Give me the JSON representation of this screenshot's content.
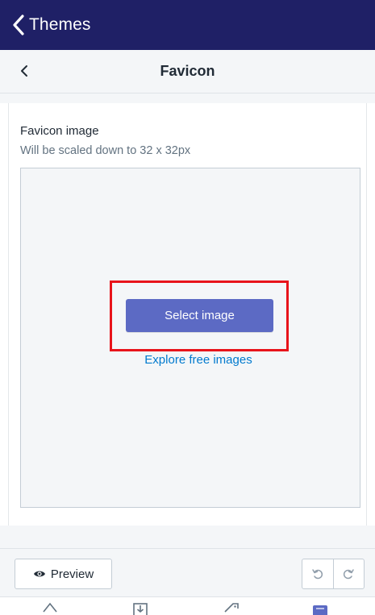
{
  "topbar": {
    "title": "Themes"
  },
  "subheader": {
    "title": "Favicon"
  },
  "field": {
    "label": "Favicon image",
    "help": "Will be scaled down to 32 x 32px",
    "select_button": "Select image",
    "explore_link": "Explore free images"
  },
  "footer": {
    "preview_label": "Preview",
    "undo_icon": "undo-icon",
    "redo_icon": "redo-icon"
  },
  "tabbar": {
    "icons": [
      "home-icon",
      "orders-icon",
      "products-icon",
      "store-icon"
    ]
  },
  "colors": {
    "topbar": "#1f2066",
    "primary_button": "#5c6ac4",
    "link": "#007ace",
    "highlight": "#e8141b"
  }
}
